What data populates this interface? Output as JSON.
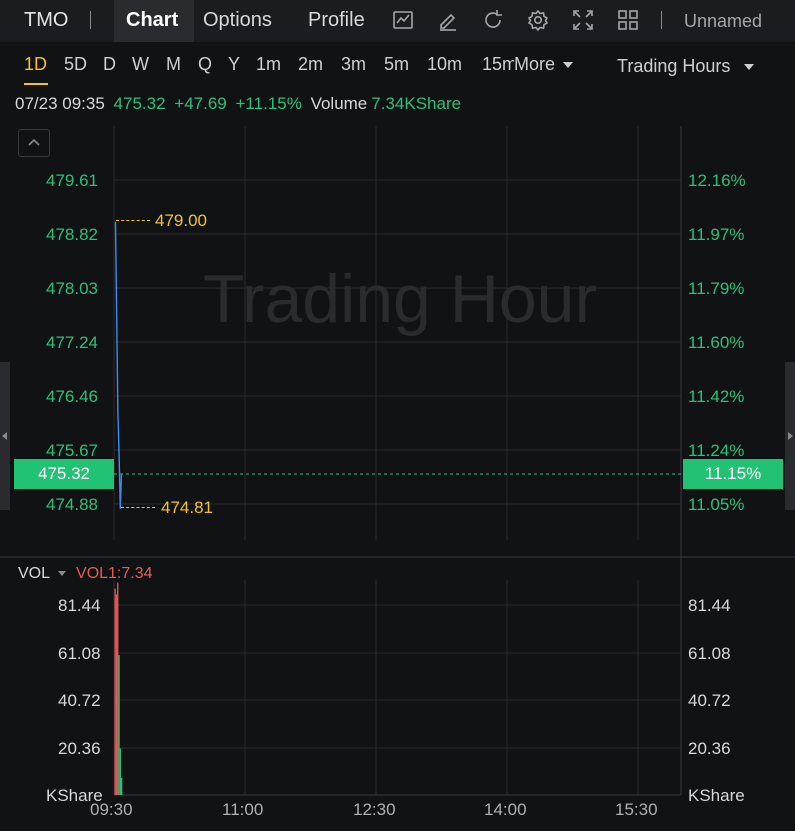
{
  "header": {
    "symbol": "TMO",
    "tabs": [
      "Chart",
      "Options",
      "Profile"
    ],
    "active_tab": "Chart",
    "icons": [
      "indicator-chart-icon",
      "draw-pen-icon",
      "refresh-icon",
      "settings-gear-icon",
      "fullscreen-icon",
      "layout-grid-icon"
    ],
    "layout_name": "Unnamed"
  },
  "periods": {
    "items": [
      "1D",
      "5D",
      "D",
      "W",
      "M",
      "Q",
      "Y",
      "1m",
      "2m",
      "3m",
      "5m",
      "10m",
      "15m"
    ],
    "active": "1D",
    "more_label": "More",
    "session_label": "Trading Hours"
  },
  "quote": {
    "datetime": "07/23 09:35",
    "price": "475.32",
    "change": "+47.69",
    "change_pct": "+11.15%",
    "volume_label": "Volume",
    "volume": "7.34KShare"
  },
  "price_chart": {
    "watermark": "Trading Hour",
    "left_ticks": [
      "479.61",
      "478.82",
      "478.03",
      "477.24",
      "476.46",
      "475.67",
      "474.88"
    ],
    "right_ticks": [
      "12.16%",
      "11.97%",
      "11.79%",
      "11.60%",
      "11.42%",
      "11.24%",
      "11.05%"
    ],
    "current_price": "475.32",
    "current_pct": "11.15%",
    "high_marker": "479.00",
    "low_marker": "474.81"
  },
  "volume_chart": {
    "indicator": "VOL",
    "vol_value": "VOL1:7.34",
    "ticks": [
      "81.44",
      "61.08",
      "40.72",
      "20.36"
    ],
    "unit": "KShare"
  },
  "x_axis": [
    "09:30",
    "11:00",
    "12:30",
    "14:00",
    "15:30"
  ],
  "colors": {
    "up": "#2ec07a",
    "accent": "#f3c230",
    "line": "#3b8cf0",
    "vol_up": "#e55b5b"
  },
  "chart_data": [
    {
      "type": "line",
      "x": [
        "09:30",
        "09:31",
        "09:32",
        "09:33",
        "09:34",
        "09:35"
      ],
      "y": [
        479.0,
        477.6,
        476.2,
        475.6,
        474.81,
        475.32
      ],
      "ylim": [
        474.6,
        479.9
      ],
      "xlabel": "",
      "ylabel": ""
    },
    {
      "type": "bar",
      "categories": [
        "09:30",
        "09:31",
        "09:32",
        "09:33",
        "09:34",
        "09:35"
      ],
      "values": [
        88.5,
        86.0,
        91.0,
        60.0,
        20.0,
        7.34
      ],
      "ylim": [
        0,
        97
      ]
    }
  ]
}
